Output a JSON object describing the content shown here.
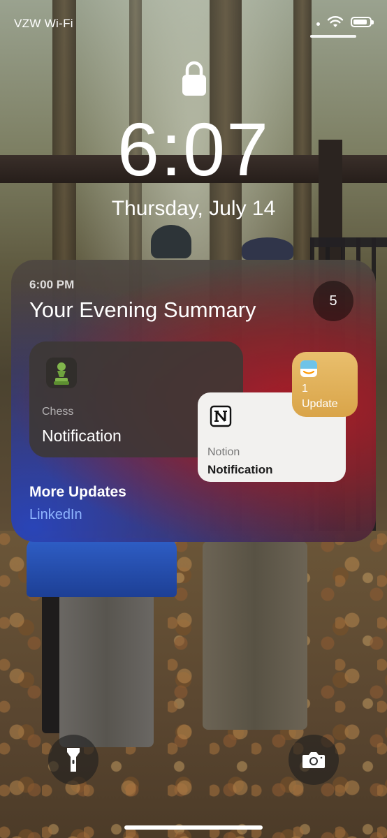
{
  "status_bar": {
    "carrier": "VZW Wi-Fi",
    "icons": [
      "dot-icon",
      "wifi-icon",
      "battery-icon"
    ],
    "battery_level": 0.85
  },
  "lock_screen": {
    "lock_icon": "lock-icon",
    "time": "6:07",
    "date": "Thursday, July 14"
  },
  "summary": {
    "time": "6:00 PM",
    "title": "Your Evening Summary",
    "count": "5",
    "colors": {
      "accent_red": "#b21a28",
      "accent_blue": "#2846be",
      "link_blue": "#8fb5ff"
    },
    "cards": {
      "chess": {
        "app": "Chess",
        "title": "Notification",
        "icon": "chess-pawn-icon"
      },
      "notion": {
        "app": "Notion",
        "title": "Notification",
        "icon": "notion-icon"
      },
      "amazon": {
        "count": "1",
        "label": "Update",
        "icon": "amazon-icon"
      }
    },
    "more": {
      "title": "More Updates",
      "app": "LinkedIn"
    }
  },
  "controls": {
    "flashlight_icon": "flashlight-icon",
    "camera_icon": "camera-icon"
  }
}
